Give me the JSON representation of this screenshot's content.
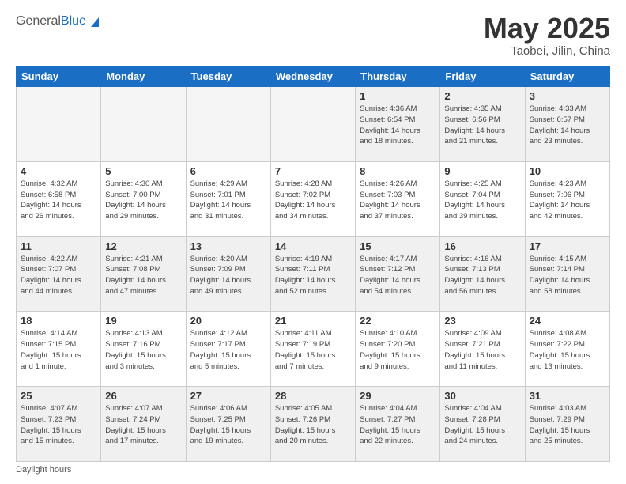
{
  "header": {
    "logo_general": "General",
    "logo_blue": "Blue",
    "month_title": "May 2025",
    "location": "Taobei, Jilin, China"
  },
  "days_of_week": [
    "Sunday",
    "Monday",
    "Tuesday",
    "Wednesday",
    "Thursday",
    "Friday",
    "Saturday"
  ],
  "footer": {
    "daylight_label": "Daylight hours"
  },
  "weeks": [
    {
      "days": [
        {
          "num": "",
          "info": "",
          "empty": true
        },
        {
          "num": "",
          "info": "",
          "empty": true
        },
        {
          "num": "",
          "info": "",
          "empty": true
        },
        {
          "num": "",
          "info": "",
          "empty": true
        },
        {
          "num": "1",
          "info": "Sunrise: 4:36 AM\nSunset: 6:54 PM\nDaylight: 14 hours\nand 18 minutes.",
          "empty": false
        },
        {
          "num": "2",
          "info": "Sunrise: 4:35 AM\nSunset: 6:56 PM\nDaylight: 14 hours\nand 21 minutes.",
          "empty": false
        },
        {
          "num": "3",
          "info": "Sunrise: 4:33 AM\nSunset: 6:57 PM\nDaylight: 14 hours\nand 23 minutes.",
          "empty": false
        }
      ]
    },
    {
      "days": [
        {
          "num": "4",
          "info": "Sunrise: 4:32 AM\nSunset: 6:58 PM\nDaylight: 14 hours\nand 26 minutes.",
          "empty": false
        },
        {
          "num": "5",
          "info": "Sunrise: 4:30 AM\nSunset: 7:00 PM\nDaylight: 14 hours\nand 29 minutes.",
          "empty": false
        },
        {
          "num": "6",
          "info": "Sunrise: 4:29 AM\nSunset: 7:01 PM\nDaylight: 14 hours\nand 31 minutes.",
          "empty": false
        },
        {
          "num": "7",
          "info": "Sunrise: 4:28 AM\nSunset: 7:02 PM\nDaylight: 14 hours\nand 34 minutes.",
          "empty": false
        },
        {
          "num": "8",
          "info": "Sunrise: 4:26 AM\nSunset: 7:03 PM\nDaylight: 14 hours\nand 37 minutes.",
          "empty": false
        },
        {
          "num": "9",
          "info": "Sunrise: 4:25 AM\nSunset: 7:04 PM\nDaylight: 14 hours\nand 39 minutes.",
          "empty": false
        },
        {
          "num": "10",
          "info": "Sunrise: 4:23 AM\nSunset: 7:06 PM\nDaylight: 14 hours\nand 42 minutes.",
          "empty": false
        }
      ]
    },
    {
      "days": [
        {
          "num": "11",
          "info": "Sunrise: 4:22 AM\nSunset: 7:07 PM\nDaylight: 14 hours\nand 44 minutes.",
          "empty": false
        },
        {
          "num": "12",
          "info": "Sunrise: 4:21 AM\nSunset: 7:08 PM\nDaylight: 14 hours\nand 47 minutes.",
          "empty": false
        },
        {
          "num": "13",
          "info": "Sunrise: 4:20 AM\nSunset: 7:09 PM\nDaylight: 14 hours\nand 49 minutes.",
          "empty": false
        },
        {
          "num": "14",
          "info": "Sunrise: 4:19 AM\nSunset: 7:11 PM\nDaylight: 14 hours\nand 52 minutes.",
          "empty": false
        },
        {
          "num": "15",
          "info": "Sunrise: 4:17 AM\nSunset: 7:12 PM\nDaylight: 14 hours\nand 54 minutes.",
          "empty": false
        },
        {
          "num": "16",
          "info": "Sunrise: 4:16 AM\nSunset: 7:13 PM\nDaylight: 14 hours\nand 56 minutes.",
          "empty": false
        },
        {
          "num": "17",
          "info": "Sunrise: 4:15 AM\nSunset: 7:14 PM\nDaylight: 14 hours\nand 58 minutes.",
          "empty": false
        }
      ]
    },
    {
      "days": [
        {
          "num": "18",
          "info": "Sunrise: 4:14 AM\nSunset: 7:15 PM\nDaylight: 15 hours\nand 1 minute.",
          "empty": false
        },
        {
          "num": "19",
          "info": "Sunrise: 4:13 AM\nSunset: 7:16 PM\nDaylight: 15 hours\nand 3 minutes.",
          "empty": false
        },
        {
          "num": "20",
          "info": "Sunrise: 4:12 AM\nSunset: 7:17 PM\nDaylight: 15 hours\nand 5 minutes.",
          "empty": false
        },
        {
          "num": "21",
          "info": "Sunrise: 4:11 AM\nSunset: 7:19 PM\nDaylight: 15 hours\nand 7 minutes.",
          "empty": false
        },
        {
          "num": "22",
          "info": "Sunrise: 4:10 AM\nSunset: 7:20 PM\nDaylight: 15 hours\nand 9 minutes.",
          "empty": false
        },
        {
          "num": "23",
          "info": "Sunrise: 4:09 AM\nSunset: 7:21 PM\nDaylight: 15 hours\nand 11 minutes.",
          "empty": false
        },
        {
          "num": "24",
          "info": "Sunrise: 4:08 AM\nSunset: 7:22 PM\nDaylight: 15 hours\nand 13 minutes.",
          "empty": false
        }
      ]
    },
    {
      "days": [
        {
          "num": "25",
          "info": "Sunrise: 4:07 AM\nSunset: 7:23 PM\nDaylight: 15 hours\nand 15 minutes.",
          "empty": false
        },
        {
          "num": "26",
          "info": "Sunrise: 4:07 AM\nSunset: 7:24 PM\nDaylight: 15 hours\nand 17 minutes.",
          "empty": false
        },
        {
          "num": "27",
          "info": "Sunrise: 4:06 AM\nSunset: 7:25 PM\nDaylight: 15 hours\nand 19 minutes.",
          "empty": false
        },
        {
          "num": "28",
          "info": "Sunrise: 4:05 AM\nSunset: 7:26 PM\nDaylight: 15 hours\nand 20 minutes.",
          "empty": false
        },
        {
          "num": "29",
          "info": "Sunrise: 4:04 AM\nSunset: 7:27 PM\nDaylight: 15 hours\nand 22 minutes.",
          "empty": false
        },
        {
          "num": "30",
          "info": "Sunrise: 4:04 AM\nSunset: 7:28 PM\nDaylight: 15 hours\nand 24 minutes.",
          "empty": false
        },
        {
          "num": "31",
          "info": "Sunrise: 4:03 AM\nSunset: 7:29 PM\nDaylight: 15 hours\nand 25 minutes.",
          "empty": false
        }
      ]
    }
  ]
}
